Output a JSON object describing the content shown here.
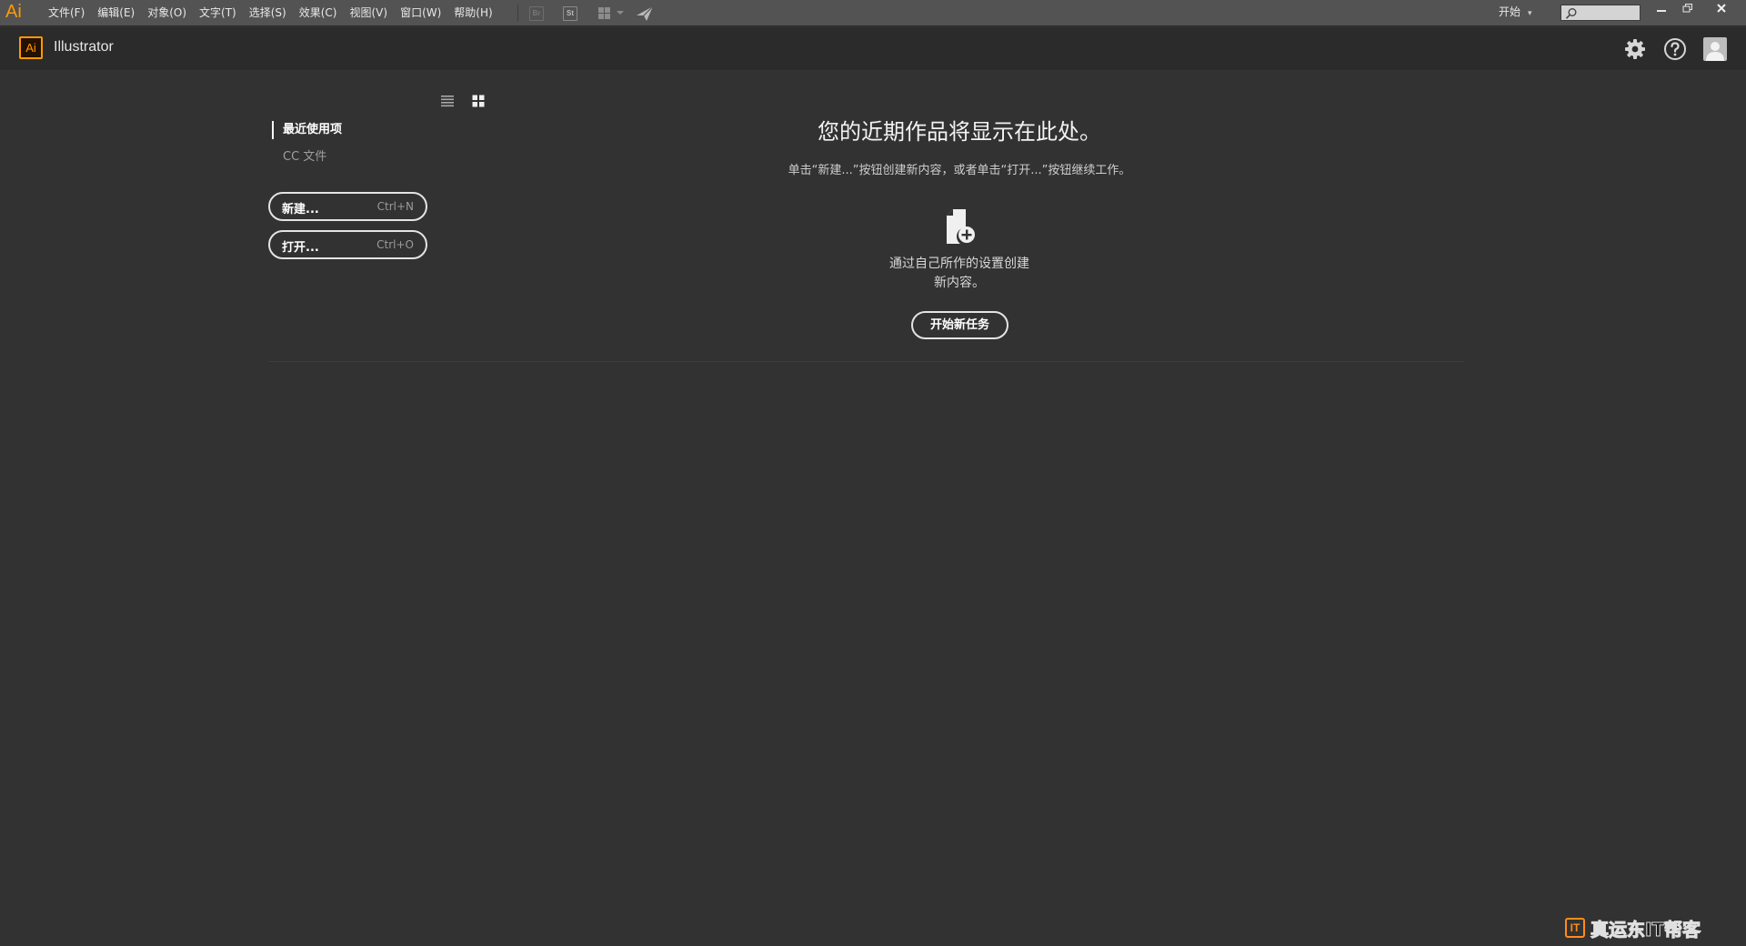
{
  "menubar": {
    "app_logo": "Ai",
    "items": [
      "文件(F)",
      "编辑(E)",
      "对象(O)",
      "文字(T)",
      "选择(S)",
      "效果(C)",
      "视图(V)",
      "窗口(W)",
      "帮助(H)"
    ],
    "bridge_icon": "Br",
    "stock_icon": "St",
    "workspace": "开始",
    "search_placeholder": ""
  },
  "titlebar": {
    "badge": "Ai",
    "app_name": "Illustrator"
  },
  "sidebar": {
    "recent_label": "最近使用项",
    "cc_files_label": "CC 文件",
    "new_button": {
      "label": "新建...",
      "shortcut": "Ctrl+N"
    },
    "open_button": {
      "label": "打开...",
      "shortcut": "Ctrl+O"
    }
  },
  "main": {
    "heading": "您的近期作品将显示在此处。",
    "subheading": "单击“新建...”按钮创建新内容，或者单击“打开...”按钮继续工作。",
    "create_desc_line1": "通过自己所作的设置创建",
    "create_desc_line2": "新内容。",
    "start_task_button": "开始新任务"
  },
  "watermark": {
    "badge": "IT",
    "text": "真运东IT帮客"
  },
  "colors": {
    "brand": "#ff9a00",
    "menubar_bg": "#535353",
    "titlebar_bg": "#2b2b2b",
    "content_bg": "#323232"
  },
  "icons": [
    "list-view-icon",
    "grid-view-icon",
    "gear-icon",
    "help-icon",
    "user-profile-icon",
    "new-document-plus-icon",
    "search-icon",
    "minimize-icon",
    "restore-icon",
    "close-icon",
    "send-plane-icon",
    "arrange-documents-icon"
  ]
}
